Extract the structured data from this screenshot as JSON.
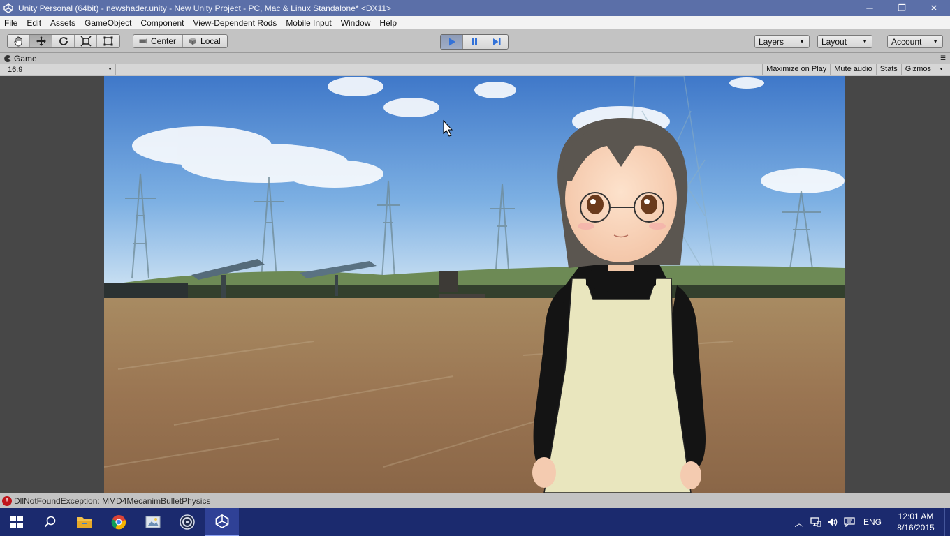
{
  "window": {
    "title": "Unity Personal (64bit) - newshader.unity - New Unity Project - PC, Mac & Linux Standalone* <DX11>",
    "minimize_glyph": "─",
    "restore_glyph": "❐",
    "close_glyph": "✕"
  },
  "menubar": {
    "items": [
      "File",
      "Edit",
      "Assets",
      "GameObject",
      "Component",
      "View-Dependent Rods",
      "Mobile Input",
      "Window",
      "Help"
    ]
  },
  "toolbar": {
    "tools": [
      "hand-icon",
      "move-icon",
      "rotate-icon",
      "scale-icon",
      "rect-icon"
    ],
    "active_tool": "move-icon",
    "pivot_label": "Center",
    "space_label": "Local",
    "play_active": true,
    "layers_label": "Layers",
    "layout_label": "Layout",
    "account_label": "Account"
  },
  "game_view": {
    "tab_label": "Game",
    "aspect_label": "16:9",
    "options": [
      "Maximize on Play",
      "Mute audio",
      "Stats",
      "Gizmos"
    ]
  },
  "status": {
    "message": "DllNotFoundException: MMD4MecanimBulletPhysics",
    "level": "error",
    "color": "#c0151b"
  },
  "taskbar": {
    "apps": [
      "start-icon",
      "search-icon",
      "file-explorer-icon",
      "chrome-icon",
      "photo-viewer-icon",
      "cinema4d-icon",
      "unity-icon"
    ],
    "active_app": "unity-icon",
    "language": "ENG",
    "time": "12:01 AM",
    "date": "8/16/2015"
  },
  "colors": {
    "titlebar": "#5b6fa8",
    "taskbar": "#1b2a6e",
    "play_accent": "#3372d8"
  }
}
